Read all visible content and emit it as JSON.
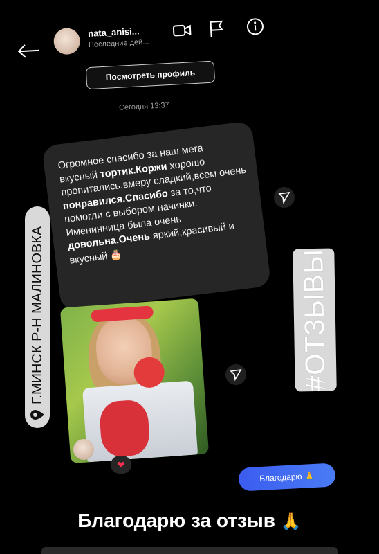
{
  "header": {
    "username": "nata_anisi...",
    "last_seen": "Последние дей...",
    "view_profile_label": "Посмотреть профиль"
  },
  "chat": {
    "timestamp": "Сегодня 13:37",
    "message_parts": [
      {
        "text": "Огромное спасибо за наш мега вкусный ",
        "bold": false
      },
      {
        "text": "тортик.Коржи",
        "bold": true
      },
      {
        "text": " хорошо пропитались,вмеру сладкий,всем очень ",
        "bold": false
      },
      {
        "text": "понравился.Спасибо",
        "bold": true
      },
      {
        "text": " за то,что помогли с выбором начинки. Именинница была очень ",
        "bold": false
      },
      {
        "text": "довольна.Очень",
        "bold": true
      },
      {
        "text": " яркий,красивый и вкусный ",
        "bold": false
      }
    ],
    "message_emoji": "🎂",
    "reaction_emoji": "❤",
    "reply_text": "Благодарю",
    "reply_emoji": "🙏"
  },
  "overlays": {
    "location": "Г.МИНСК Р-Н МАЛИНОВКА",
    "hashtag": "#ОТЗЫВЫ",
    "caption": "Благодарю за отзыв",
    "caption_emoji": "🙏"
  },
  "icons": [
    "back-arrow-icon",
    "video-call-icon",
    "flag-icon",
    "info-icon",
    "send-icon",
    "heart-icon",
    "location-pin-icon"
  ],
  "colors": {
    "background": "#000000",
    "bubble": "#262626",
    "reply": "#3b5cf0",
    "tag": "#d9d9d9"
  }
}
